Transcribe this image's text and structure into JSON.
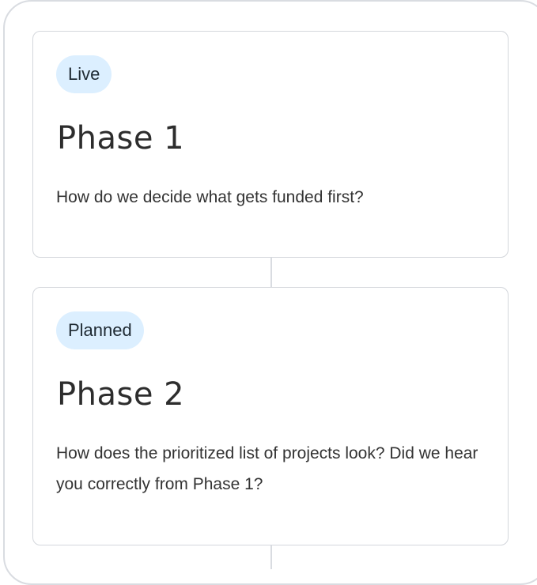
{
  "phases": [
    {
      "status": "Live",
      "title": "Phase 1",
      "description": "How do we decide what gets funded first?"
    },
    {
      "status": "Planned",
      "title": "Phase 2",
      "description": "How does the prioritized list of projects look? Did we hear you correctly from Phase 1?"
    }
  ],
  "colors": {
    "badge_background": "#dcefff",
    "border": "#d4d7dc",
    "text": "#2d2d2d"
  }
}
